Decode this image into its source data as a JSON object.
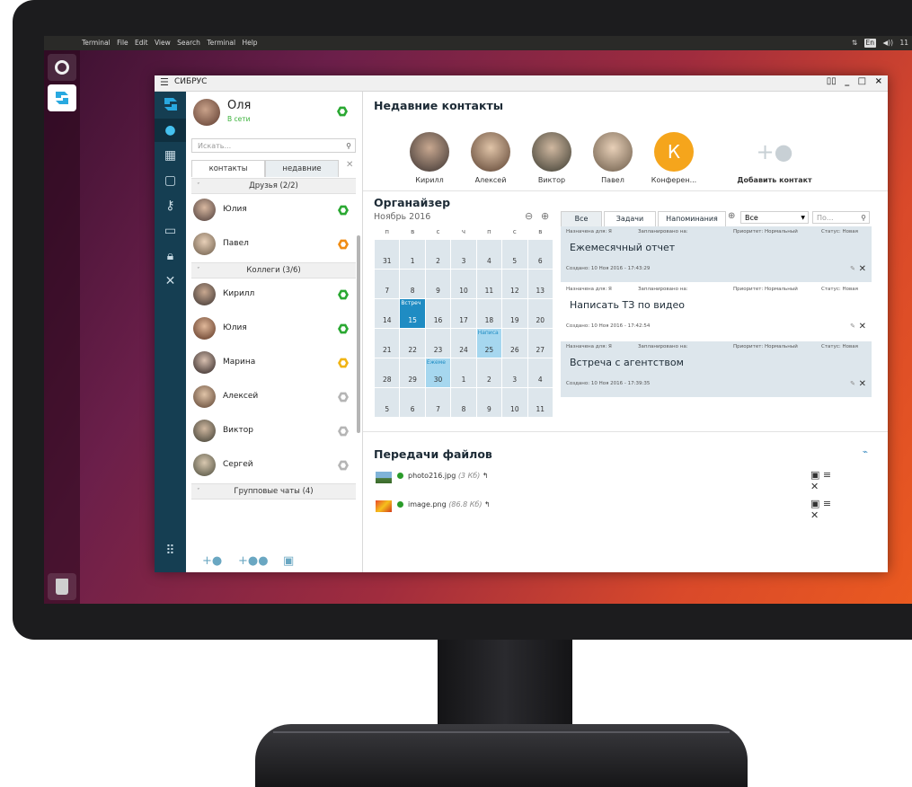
{
  "desktop": {
    "menu": [
      "Terminal",
      "File",
      "Edit",
      "View",
      "Search",
      "Terminal",
      "Help"
    ],
    "tray": {
      "keyboard": "En",
      "volume": "◀))",
      "clock": "11"
    }
  },
  "app": {
    "title": "СИБРУС",
    "me": {
      "name": "Оля",
      "status": "В сети"
    },
    "search_placeholder": "Искать...",
    "tabs": {
      "contacts": "контакты",
      "recent": "недавние"
    },
    "groups": {
      "friends": "Друзья (2/2)",
      "colleagues": "Коллеги (3/6)",
      "group_chats": "Групповые чаты (4)"
    },
    "contacts": [
      {
        "name": "Юлия",
        "status_color": "#2aa832"
      },
      {
        "name": "Павел",
        "status_color": "#f08c14"
      },
      {
        "name": "Кирилл",
        "status_color": "#2aa832"
      },
      {
        "name": "Юлия",
        "status_color": "#2aa832"
      },
      {
        "name": "Марина",
        "status_color": "#f0b414"
      },
      {
        "name": "Алексей",
        "status_color": "#b5b5b5"
      },
      {
        "name": "Виктор",
        "status_color": "#b5b5b5"
      },
      {
        "name": "Сергей",
        "status_color": "#b5b5b5"
      }
    ],
    "main": {
      "recent_title": "Недавние контакты",
      "recent": [
        {
          "name": "Кирилл"
        },
        {
          "name": "Алексей"
        },
        {
          "name": "Виктор"
        },
        {
          "name": "Павел"
        },
        {
          "name": "Конферен...",
          "letter": "К"
        }
      ],
      "add_contact": "Добавить контакт",
      "organizer_title": "Органайзер",
      "calendar": {
        "month": "Ноябрь 2016",
        "weekdays": [
          "п",
          "в",
          "с",
          "ч",
          "п",
          "с",
          "в"
        ],
        "weeks": [
          [
            "",
            "",
            "",
            "",
            "",
            "",
            ""
          ],
          [
            "31",
            "1",
            "2",
            "3",
            "4",
            "5",
            "6"
          ],
          [
            "7",
            "8",
            "9",
            "10",
            "11",
            "12",
            "13"
          ],
          [
            "14",
            "15",
            "16",
            "17",
            "18",
            "19",
            "20"
          ],
          [
            "21",
            "22",
            "23",
            "24",
            "25",
            "26",
            "27"
          ],
          [
            "28",
            "29",
            "30",
            "1",
            "2",
            "3",
            "4"
          ],
          [
            "5",
            "6",
            "7",
            "8",
            "9",
            "10",
            "11"
          ]
        ],
        "events": {
          "15": "Встреч",
          "25": "Написа",
          "30": "Ежеме"
        }
      },
      "task_tabs": [
        "Все",
        "Задачи",
        "Напоминания"
      ],
      "task_filter": "Все",
      "task_search": "По...",
      "tasks": [
        {
          "assigned": "Назначена для: Я",
          "planned": "Запланировано на:",
          "priority": "Приоритет: Нормальный",
          "status": "Статус: Новая",
          "title": "Ежемесячный отчет",
          "created": "Создано: 10 Ноя 2016 - 17:43:29"
        },
        {
          "assigned": "Назначена для: Я",
          "planned": "Запланировано на:",
          "priority": "Приоритет: Нормальный",
          "status": "Статус: Новая",
          "title": "Написать ТЗ по видео",
          "created": "Создано: 10 Ноя 2016 - 17:42:54"
        },
        {
          "assigned": "Назначена для: Я",
          "planned": "Запланировано на:",
          "priority": "Приоритет: Нормальный",
          "status": "Статус: Новая",
          "title": "Встреча с агентством",
          "created": "Создано: 10 Ноя 2016 - 17:39:35"
        }
      ],
      "transfers_title": "Передачи файлов",
      "transfers": [
        {
          "file": "photo216.jpg",
          "size": "(3 Кб)"
        },
        {
          "file": "image.png",
          "size": "(86.8 Кб)"
        }
      ]
    }
  }
}
